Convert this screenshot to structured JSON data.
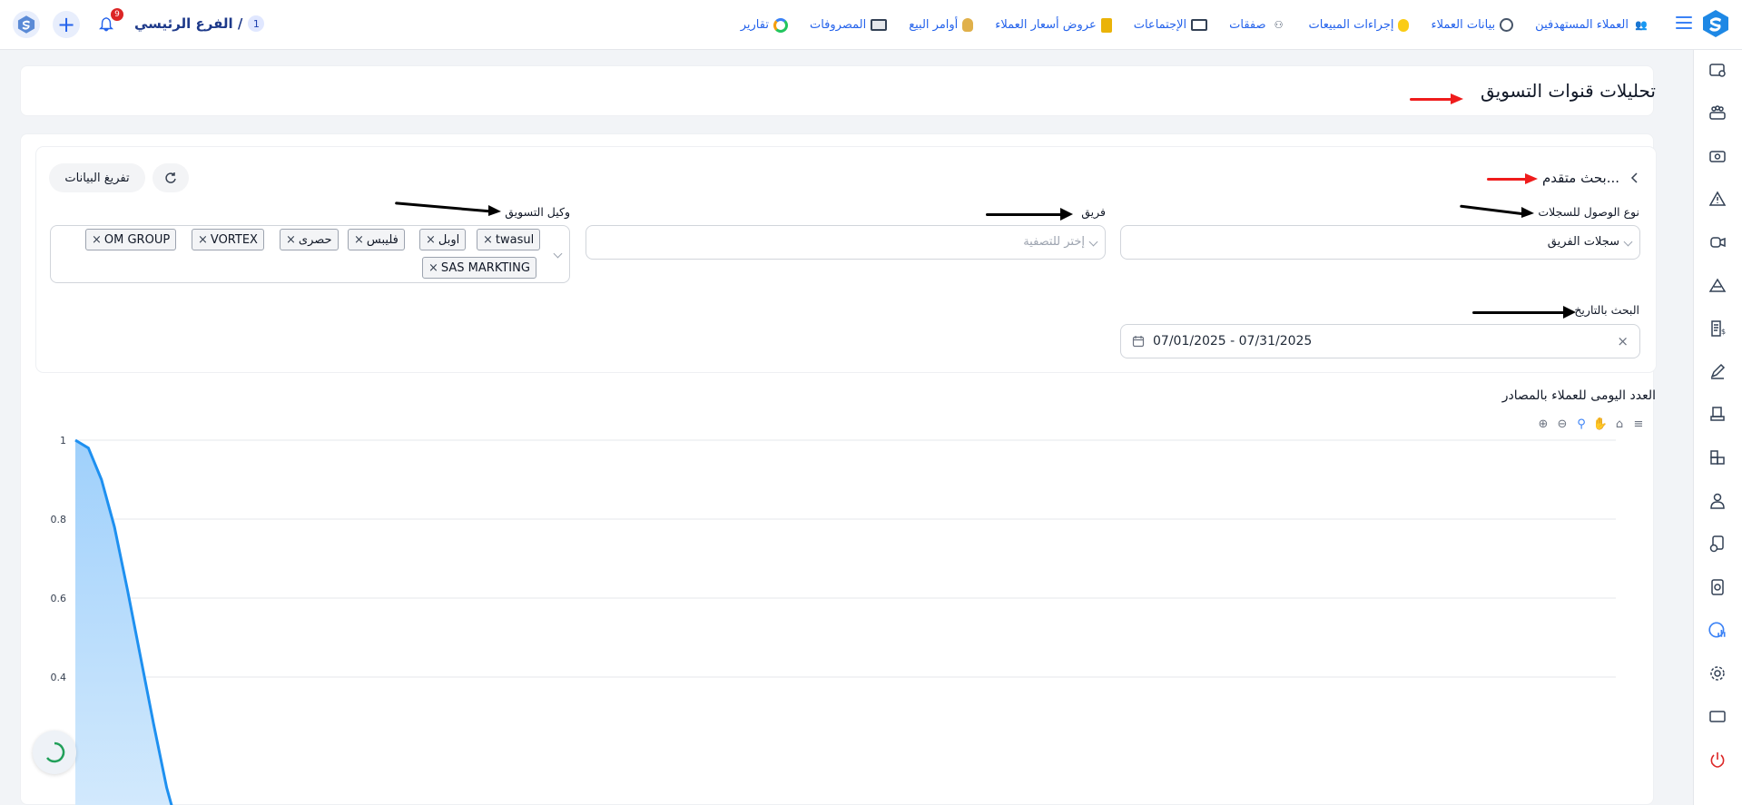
{
  "header": {
    "nav": [
      {
        "label": "العملاء المستهدفين",
        "icon": "target-customers-icon"
      },
      {
        "label": "بيانات العملاء",
        "icon": "customer-data-icon"
      },
      {
        "label": "إجراءات المبيعات",
        "icon": "sales-actions-icon"
      },
      {
        "label": "صفقات",
        "icon": "deals-icon"
      },
      {
        "label": "الإجتماعات",
        "icon": "meetings-icon"
      },
      {
        "label": "عروض أسعار العملاء",
        "icon": "quotes-icon"
      },
      {
        "label": "أوامر البيع",
        "icon": "sales-orders-icon"
      },
      {
        "label": "المصروفات",
        "icon": "expenses-icon"
      },
      {
        "label": "تقارير",
        "icon": "reports-icon"
      }
    ],
    "branch_name": "الفرع الرئيسي /",
    "branch_number": "1",
    "notification_count": "9"
  },
  "page": {
    "title": "تحليلات قنوات التسويق"
  },
  "filters": {
    "advanced_search": "بحث متقدم...",
    "access_type_label": "نوع الوصول للسجلات",
    "access_type_value": "سجلات الفريق",
    "team_label": "فريق",
    "team_placeholder": "إختر للتصفية",
    "agent_label": "وكيل التسويق",
    "agent_tags": [
      "twasul",
      "اوبل",
      "فليبس",
      "حصرى",
      "VORTEX",
      "OM GROUP",
      "SAS MARKTING"
    ],
    "date_label": "البحث بالتاريخ",
    "date_value": "07/01/2025 - 07/31/2025",
    "clear_button": "تفريغ البيانات"
  },
  "chart_data": {
    "type": "area",
    "title": "العدد اليومى للعملاء بالمصادر",
    "yticks": [
      "1",
      "0.8",
      "0.6",
      "0.4"
    ],
    "ylim": [
      0,
      1
    ],
    "series": [
      {
        "values": [
          1,
          0.98,
          0.9,
          0.78,
          0.62,
          0.45,
          0.28,
          0.12,
          0.0
        ]
      }
    ],
    "color": "#1e90f0",
    "grid": true
  },
  "colors": {
    "accent": "#2563eb",
    "arrow_red": "#ef1c1c",
    "arrow_black": "#000000"
  }
}
